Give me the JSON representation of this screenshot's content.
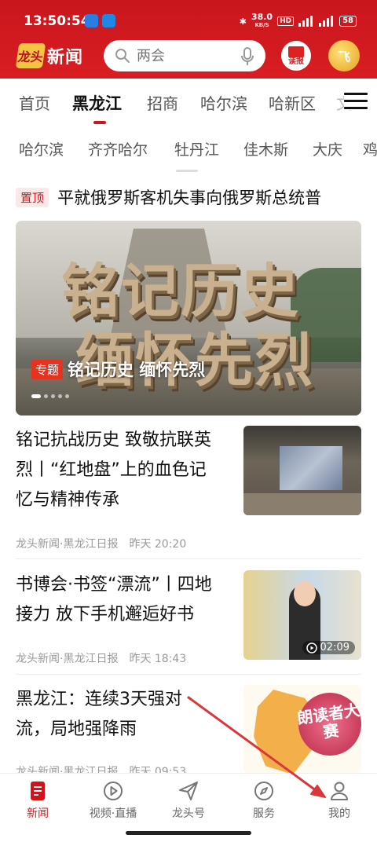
{
  "status_bar": {
    "time": "13:50:54",
    "net_speed_top": "38.0",
    "net_speed_unit": "KB/S",
    "hd": "HD",
    "sig1": "5G",
    "sig2": "5G",
    "battery": "58"
  },
  "header": {
    "logo_mark": "龙头",
    "logo_text": "新闻",
    "search_placeholder": "两会",
    "dubao_label": "读报",
    "ai_label": "飞"
  },
  "channels": {
    "tabs": [
      "首页",
      "黑龙江",
      "招商",
      "哈尔滨",
      "哈新区",
      "文"
    ],
    "active_index": 1
  },
  "regions": {
    "items": [
      "哈尔滨",
      "齐齐哈尔",
      "牡丹江",
      "佳木斯",
      "大庆",
      "鸡"
    ]
  },
  "pinned": {
    "badge": "置顶",
    "title": "平就俄罗斯客机失事向俄罗斯总统普"
  },
  "banner": {
    "big_line1": "铭记历史",
    "big_line2": "缅怀先烈",
    "tag": "专题",
    "title": "铭记历史 缅怀先烈",
    "slide_count": 5,
    "active_slide": 0
  },
  "news": [
    {
      "title": "铭记抗战历史 致敬抗联英烈丨“红地盘”上的血色记忆与精神传承",
      "source": "龙头新闻·黑龙江日报",
      "time": "昨天 20:20"
    },
    {
      "title": "书博会·书签“漂流”丨四地接力 放下手机邂逅好书",
      "source": "龙头新闻·黑龙江日报",
      "time": "昨天 18:43",
      "video_duration": "02:09"
    },
    {
      "title": "黑龙江：连续3天强对流，局地强降雨",
      "source": "龙头新闻·黑龙江日报",
      "time": "昨天 09:53",
      "thumb_text": "朗读者大赛"
    }
  ],
  "bottom_nav": {
    "items": [
      "新闻",
      "视频·直播",
      "龙头号",
      "服务",
      "我的"
    ],
    "active_index": 0
  },
  "colors": {
    "brand_red": "#d3131c",
    "annotation_arrow": "#d9363e"
  }
}
